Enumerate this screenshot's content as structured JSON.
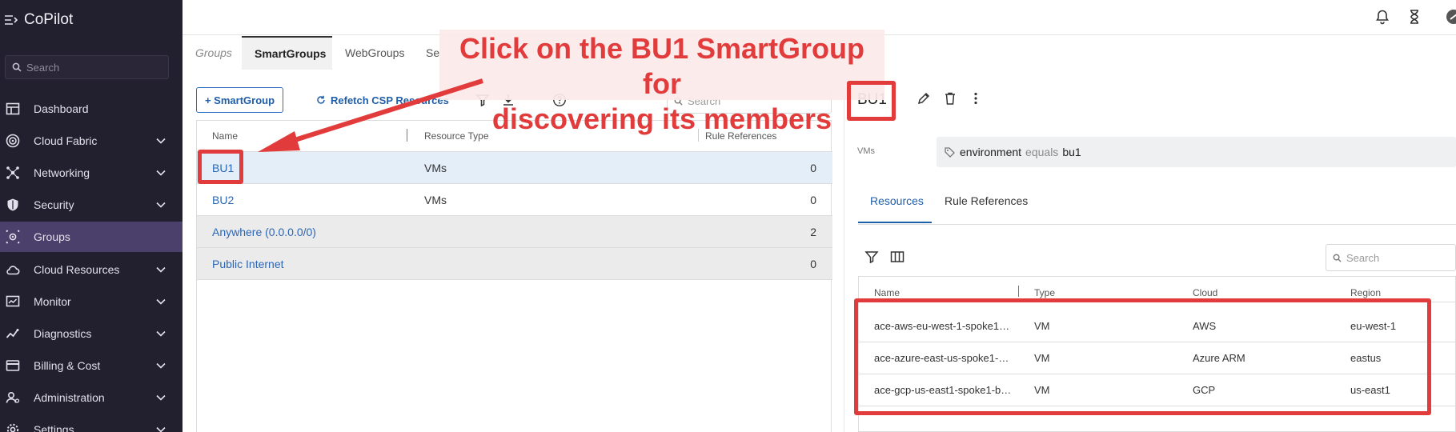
{
  "app": {
    "title": "CoPilot"
  },
  "sidebar": {
    "search_placeholder": "Search",
    "items": [
      {
        "label": "Dashboard",
        "icon": "dashboard-icon"
      },
      {
        "label": "Cloud Fabric",
        "icon": "cloud-fabric-icon"
      },
      {
        "label": "Networking",
        "icon": "networking-icon"
      },
      {
        "label": "Security",
        "icon": "shield-icon"
      },
      {
        "label": "Groups",
        "icon": "groups-icon"
      },
      {
        "label": "Cloud Resources",
        "icon": "cloud-icon"
      },
      {
        "label": "Monitor",
        "icon": "monitor-icon"
      },
      {
        "label": "Diagnostics",
        "icon": "diagnostics-icon"
      },
      {
        "label": "Billing & Cost",
        "icon": "billing-icon"
      },
      {
        "label": "Administration",
        "icon": "administration-icon"
      },
      {
        "label": "Settings",
        "icon": "settings-icon"
      }
    ],
    "active_item": "Groups"
  },
  "tabs": [
    {
      "label": "Groups"
    },
    {
      "label": "SmartGroups"
    },
    {
      "label": "WebGroups"
    },
    {
      "label": "Se"
    }
  ],
  "toolbar": {
    "add_label": "+ SmartGroup",
    "refetch_label": "Refetch CSP Resources",
    "search_placeholder": "Search"
  },
  "groups_table": {
    "columns": [
      "Name",
      "Resource Type",
      "Rule References"
    ],
    "rows": [
      {
        "name": "BU1",
        "type": "VMs",
        "refs": "0"
      },
      {
        "name": "BU2",
        "type": "VMs",
        "refs": "0"
      },
      {
        "name": "Anywhere (0.0.0.0/0)",
        "type": "",
        "refs": "2"
      },
      {
        "name": "Public Internet",
        "type": "",
        "refs": "0"
      }
    ]
  },
  "detail": {
    "title": "BU1",
    "vms_label": "VMs",
    "rule": {
      "key": "environment",
      "operator": "equals",
      "value": "bu1"
    },
    "tabs": [
      "Resources",
      "Rule References"
    ],
    "search_placeholder": "Search",
    "resources": {
      "columns": [
        "Name",
        "Type",
        "Cloud",
        "Region"
      ],
      "rows": [
        {
          "name": "ace-aws-eu-west-1-spoke1…",
          "type": "VM",
          "cloud": "AWS",
          "region": "eu-west-1"
        },
        {
          "name": "ace-azure-east-us-spoke1-…",
          "type": "VM",
          "cloud": "Azure ARM",
          "region": "eastus"
        },
        {
          "name": "ace-gcp-us-east1-spoke1-b…",
          "type": "VM",
          "cloud": "GCP",
          "region": "us-east1"
        }
      ]
    }
  },
  "annotation": {
    "line1": "Click on the BU1 SmartGroup for",
    "line2": "discovering its members",
    "color": "#e23b3b"
  },
  "colors": {
    "sidebar_bg": "#221f2e",
    "sidebar_active": "#4b3f6b",
    "link": "#2b67b5"
  }
}
